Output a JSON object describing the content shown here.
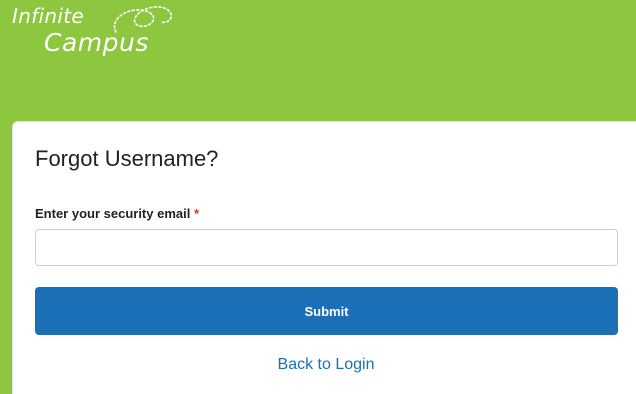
{
  "brand": {
    "line1": "Infinite",
    "line2": "Campus",
    "header_color": "#8dc63f"
  },
  "form": {
    "title": "Forgot Username?",
    "email_label": "Enter your security email",
    "required_marker": "*",
    "email_value": "",
    "email_placeholder": "",
    "submit_label": "Submit",
    "back_link_label": "Back to Login",
    "accent_color": "#1a6fb7"
  }
}
